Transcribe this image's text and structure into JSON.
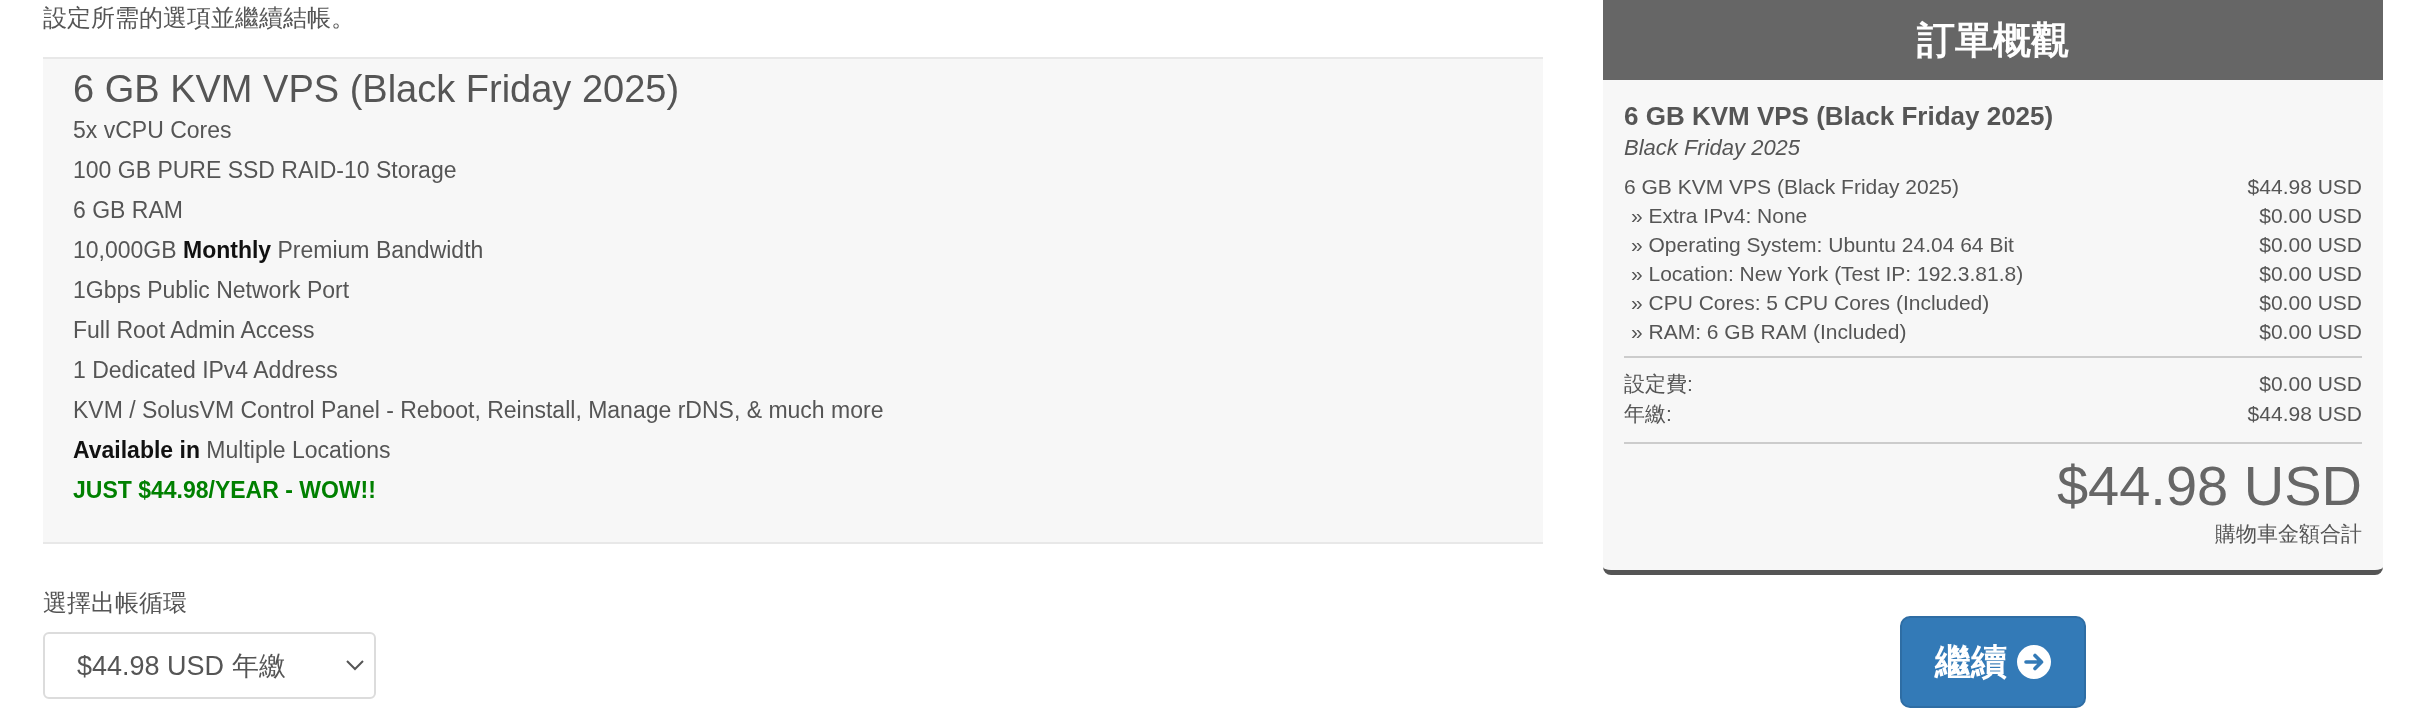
{
  "intro": "設定所需的選項並繼續結帳。",
  "product": {
    "title": "6 GB KVM VPS (Black Friday 2025)",
    "features": [
      {
        "kind": "plain",
        "text": "5x vCPU Cores"
      },
      {
        "kind": "plain",
        "text": "100 GB PURE SSD RAID-10 Storage"
      },
      {
        "kind": "plain",
        "text": "6 GB RAM"
      },
      {
        "kind": "plain",
        "text": "10,000GB **Monthly** Premium Bandwidth"
      },
      {
        "kind": "plain",
        "text": "1Gbps Public Network Port"
      },
      {
        "kind": "plain",
        "text": "Full Root Admin Access"
      },
      {
        "kind": "plain",
        "text": "1 Dedicated IPv4 Address"
      },
      {
        "kind": "plain",
        "text": "KVM / SolusVM Control Panel - Reboot, Reinstall, Manage rDNS, & much more"
      },
      {
        "kind": "plain",
        "text": "**Available in** Multiple Locations"
      },
      {
        "kind": "promo",
        "text": "JUST $44.98/YEAR - WOW!!"
      }
    ]
  },
  "billing_cycle": {
    "label": "選擇出帳循環",
    "value": "$44.98 USD 年繳"
  },
  "order_summary": {
    "title": "訂單概觀",
    "product_name": "6 GB KVM VPS (Black Friday 2025)",
    "product_group": "Black Friday 2025",
    "items": [
      {
        "kind": "main",
        "label": "6 GB KVM VPS (Black Friday 2025)",
        "price": "$44.98 USD"
      },
      {
        "kind": "option",
        "label": "» Extra IPv4: None",
        "price": "$0.00 USD"
      },
      {
        "kind": "option",
        "label": "» Operating System: Ubuntu 24.04 64 Bit",
        "price": "$0.00 USD"
      },
      {
        "kind": "option",
        "label": "» Location: New York (Test IP: 192.3.81.8)",
        "price": "$0.00 USD"
      },
      {
        "kind": "option",
        "label": "» CPU Cores: 5 CPU Cores (Included)",
        "price": "$0.00 USD"
      },
      {
        "kind": "option",
        "label": "» RAM: 6 GB RAM (Included)",
        "price": "$0.00 USD"
      }
    ],
    "fees": [
      {
        "label": "設定費:",
        "price": "$0.00 USD"
      },
      {
        "label": "年繳:",
        "price": "$44.98 USD"
      }
    ],
    "total": "$44.98 USD",
    "total_label": "購物車金額合計"
  },
  "continue_button": "繼續"
}
